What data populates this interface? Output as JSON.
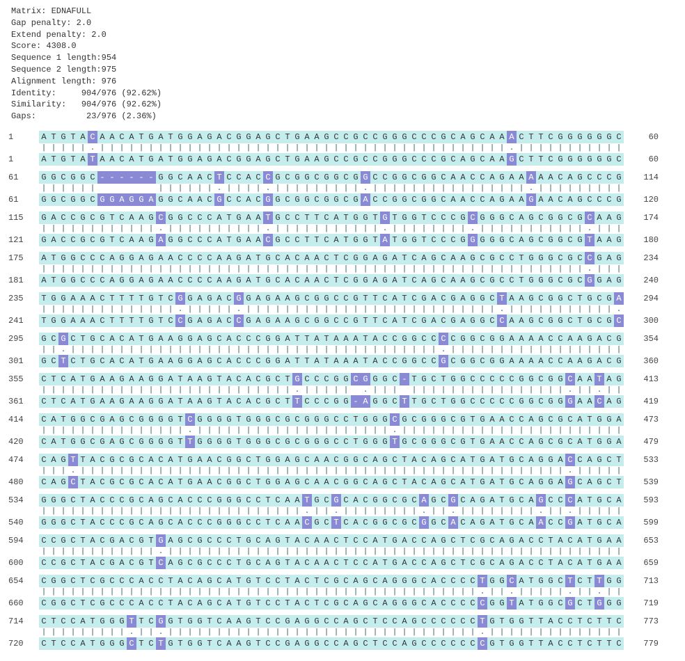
{
  "header": {
    "matrix": "Matrix: EDNAFULL",
    "gap_penalty": "Gap penalty: 2.0",
    "extend_penalty": "Extend penalty: 2.0",
    "score": "Score: 4308.0",
    "seq1_len": "Sequence 1 length:954",
    "seq2_len": "Sequence 2 length:975",
    "align_len": "Alignment length: 976",
    "identity": "Identity:     904/976 (92.62%)",
    "similarity": "Similarity:   904/976 (92.62%)",
    "gaps": "Gaps:          23/976 (2.36%)"
  },
  "blocks": [
    {
      "s1_start": "1",
      "s1_end": "60",
      "s2_start": "1",
      "s2_end": "60",
      "seq1": "ATGTACAACATGATGGAGACGGAGCTGAAGCCGCCGGGCCCGCAGCAAACTTCGGGGGGC",
      "seq2": "ATGTATAACATGATGGAGACGGAGCTGAAGCCGCCGGGCCCGCAGCAAGCTTCGGGGGGC",
      "diff": [
        {
          "i": 5,
          "a": "C",
          "b": "T"
        },
        {
          "i": 48,
          "a": "A",
          "b": "G"
        }
      ]
    },
    {
      "s1_start": "61",
      "s1_end": "114",
      "s2_start": "61",
      "s2_end": "120",
      "seq1": "GGCGGC------GGCAACTCCACCGCGGCGGCGGCCGGCGGCAACCAGAAAAACAGCCCG",
      "seq2": "GGCGGCGGAGGAGGCAACGCCACGGCGGCGGCGACCGGCGGCAACCAGAAGAACAGCCCG",
      "diff": [
        {
          "i": 6,
          "a": "-",
          "b": "G"
        },
        {
          "i": 7,
          "a": "-",
          "b": "G"
        },
        {
          "i": 8,
          "a": "-",
          "b": "A"
        },
        {
          "i": 9,
          "a": "-",
          "b": "G"
        },
        {
          "i": 10,
          "a": "-",
          "b": "G"
        },
        {
          "i": 11,
          "a": "-",
          "b": "A"
        },
        {
          "i": 18,
          "a": "T",
          "b": "G"
        },
        {
          "i": 23,
          "a": "C",
          "b": "G"
        },
        {
          "i": 33,
          "a": "G",
          "b": "A"
        },
        {
          "i": 50,
          "a": "A",
          "b": "G"
        }
      ]
    },
    {
      "s1_start": "115",
      "s1_end": "174",
      "s2_start": "121",
      "s2_end": "180",
      "seq1": "GACCGCGTCAAGCGGCCCATGAATGCCTTCATGGTGTGGTCCCGCGGGCAGCGGCGCAAG",
      "seq2": "GACCGCGTCAAGAGGCCCATGAACGCCTTCATGGTATGGTCCCGGGGGCAGCGGCGTAAG",
      "diff": [
        {
          "i": 12,
          "a": "C",
          "b": "A"
        },
        {
          "i": 23,
          "a": "T",
          "b": "C"
        },
        {
          "i": 35,
          "a": "G",
          "b": "A"
        },
        {
          "i": 44,
          "a": "C",
          "b": "G"
        },
        {
          "i": 56,
          "a": "C",
          "b": "T"
        }
      ]
    },
    {
      "s1_start": "175",
      "s1_end": "234",
      "s2_start": "181",
      "s2_end": "240",
      "seq1": "ATGGCCCAGGAGAACCCCAAGATGCACAACTCGGAGATCAGCAAGCGCCTGGGCGCCGAG",
      "seq2": "ATGGCCCAGGAGAACCCCAAGATGCACAACTCGGAGATCAGCAAGCGCCTGGGCGCGGAG",
      "diff": [
        {
          "i": 56,
          "a": "C",
          "b": "G"
        }
      ]
    },
    {
      "s1_start": "235",
      "s1_end": "294",
      "s2_start": "241",
      "s2_end": "300",
      "seq1": "TGGAAACTTTTGTCGGAGACGGAGAAGCGGCCGTTCATCGACGAGGCTAAGCGGCTGCGA",
      "seq2": "TGGAAACTTTTGTCCGAGACCGAGAAGCGGCCGTTCATCGACGAGGCCAAGCGGCTGCGC",
      "diff": [
        {
          "i": 14,
          "a": "G",
          "b": "C"
        },
        {
          "i": 20,
          "a": "G",
          "b": "C"
        },
        {
          "i": 47,
          "a": "T",
          "b": "C"
        },
        {
          "i": 59,
          "a": "A",
          "b": "C"
        }
      ]
    },
    {
      "s1_start": "295",
      "s1_end": "354",
      "s2_start": "301",
      "s2_end": "360",
      "seq1": "GCGCTGCACATGAAGGAGCACCCGGATTATAAATACCGGCCCCGGCGGAAAACCAAGACG",
      "seq2": "GCTCTGCACATGAAGGAGCACCCGGATTATAAATACCGGCCGCGGCGGAAAACCAAGACG",
      "diff": [
        {
          "i": 2,
          "a": "G",
          "b": "T"
        },
        {
          "i": 41,
          "a": "C",
          "b": "G"
        }
      ]
    },
    {
      "s1_start": "355",
      "s1_end": "413",
      "s2_start": "361",
      "s2_end": "419",
      "seq1": "CTCATGAAGAAGGATAAGTACACGCTGCCCGGCGGGC-TGCTGGCCCCCGGCGGCAATAG",
      "seq2": "CTCATGAAGAAGGATAAGTACACGCTTCCCGG-AGGCTTGCTGGCCCCCGGCGGGAACAG",
      "diff": [
        {
          "i": 26,
          "a": "G",
          "b": "T"
        },
        {
          "i": 32,
          "a": "C",
          "b": "-"
        },
        {
          "i": 33,
          "a": "G",
          "b": "A"
        },
        {
          "i": 37,
          "a": "-",
          "b": "T"
        },
        {
          "i": 54,
          "a": "C",
          "b": "G"
        },
        {
          "i": 57,
          "a": "T",
          "b": "C"
        }
      ]
    },
    {
      "s1_start": "414",
      "s1_end": "473",
      "s2_start": "420",
      "s2_end": "479",
      "seq1": "CATGGCGAGCGGGGTCGGGGTGGGCGCGGGCCTGGGCGCGGGCGTGAACCAGCGCATGGA",
      "seq2": "CATGGCGAGCGGGGTTGGGGTGGGCGCGGGCCTGGGTGCGGGCGTGAACCAGCGCATGGA",
      "diff": [
        {
          "i": 15,
          "a": "C",
          "b": "T"
        },
        {
          "i": 36,
          "a": "C",
          "b": "T"
        }
      ]
    },
    {
      "s1_start": "474",
      "s1_end": "533",
      "s2_start": "480",
      "s2_end": "539",
      "seq1": "CAGTTACGCGCACATGAACGGCTGGAGCAACGGCAGCTACAGCATGATGCAGGACCAGCT",
      "seq2": "CAGCTACGCGCACATGAACGGCTGGAGCAACGGCAGCTACAGCATGATGCAGGAGCAGCT",
      "diff": [
        {
          "i": 3,
          "a": "T",
          "b": "C"
        },
        {
          "i": 54,
          "a": "C",
          "b": "G"
        }
      ]
    },
    {
      "s1_start": "534",
      "s1_end": "593",
      "s2_start": "540",
      "s2_end": "599",
      "seq1": "GGGCTACCCGCAGCACCCGGGCCTCAATGCGCACGGCGCAGCGCAGATGCAGCCCATGCA",
      "seq2": "GGGCTACCCGCAGCACCCGGGCCTCAACGCTCACGGCGCGGCACAGATGCAACCGATGCA",
      "diff": [
        {
          "i": 27,
          "a": "T",
          "b": "C"
        },
        {
          "i": 30,
          "a": "G",
          "b": "T"
        },
        {
          "i": 39,
          "a": "A",
          "b": "G"
        },
        {
          "i": 42,
          "a": "G",
          "b": "A"
        },
        {
          "i": 51,
          "a": "G",
          "b": "A"
        },
        {
          "i": 54,
          "a": "C",
          "b": "G"
        }
      ]
    },
    {
      "s1_start": "594",
      "s1_end": "653",
      "s2_start": "600",
      "s2_end": "659",
      "seq1": "CCGCTACGACGTGAGCGCCCTGCAGTACAACTCCATGACCAGCTCGCAGACCTACATGAA",
      "seq2": "CCGCTACGACGTCAGCGCCCTGCAGTACAACTCCATGACCAGCTCGCAGACCTACATGAA",
      "diff": [
        {
          "i": 12,
          "a": "G",
          "b": "C"
        }
      ]
    },
    {
      "s1_start": "654",
      "s1_end": "713",
      "s2_start": "660",
      "s2_end": "719",
      "seq1": "CGGCTCGCCCACCTACAGCATGTCCTACTCGCAGCAGGGCACCCCTGGCATGGCTCTTGG",
      "seq2": "CGGCTCGCCCACCTACAGCATGTCCTACTCGCAGCAGGGCACCCCCGGTATGGCGCTGGG",
      "diff": [
        {
          "i": 45,
          "a": "T",
          "b": "C"
        },
        {
          "i": 48,
          "a": "C",
          "b": "T"
        },
        {
          "i": 54,
          "a": "T",
          "b": "G"
        },
        {
          "i": 57,
          "a": "T",
          "b": "G"
        }
      ]
    },
    {
      "s1_start": "714",
      "s1_end": "773",
      "s2_start": "720",
      "s2_end": "779",
      "seq1": "CTCCATGGGTTCGGTGGTCAAGTCCGAGGCCAGCTCCAGCCCCCCTGTGGTTACCTCTTC",
      "seq2": "CTCCATGGGCTCTGTGGTCAAGTCCGAGGCCAGCTCCAGCCCCCCCGTGGTTACCTCTTC",
      "diff": [
        {
          "i": 9,
          "a": "T",
          "b": "C"
        },
        {
          "i": 12,
          "a": "G",
          "b": "T"
        },
        {
          "i": 45,
          "a": "T",
          "b": "C"
        }
      ]
    }
  ]
}
